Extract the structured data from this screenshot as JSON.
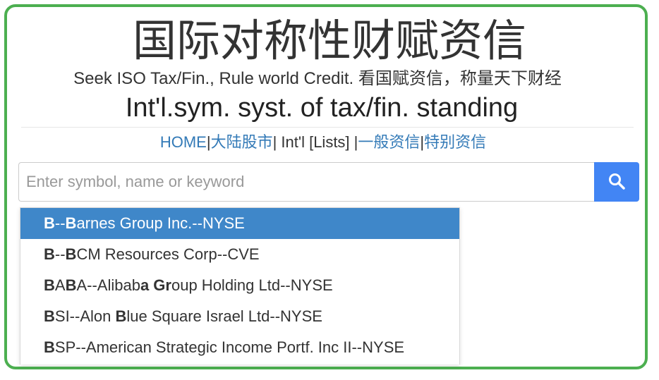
{
  "header": {
    "title": "国际对称性财赋资信",
    "subtitle": "Seek ISO Tax/Fin., Rule world Credit. 看国赋资信，称量天下财经",
    "tagline": "Int'l.sym. syst. of tax/fin. standing"
  },
  "nav": {
    "home": "HOME",
    "sep1": "|",
    "mainland_stocks": "大陆股市",
    "sep2": "|",
    "intl_lists": " Int'l [Lists] ",
    "sep3": "|",
    "general_credit": "一般资信",
    "sep4": "|",
    "special_credit": "特别资信"
  },
  "search": {
    "placeholder": "Enter symbol, name or keyword",
    "value": "",
    "button_icon": "search-icon"
  },
  "dropdown": {
    "items": [
      {
        "text": "B--Barnes Group Inc.--NYSE",
        "selected": true
      },
      {
        "text": "B--BCM Resources Corp--CVE",
        "selected": false
      },
      {
        "text": "BABA--Alibaba Group Holding Ltd--NYSE",
        "selected": false
      },
      {
        "text": "BSI--Alon Blue Square Israel Ltd--NYSE",
        "selected": false
      },
      {
        "text": "BSP--American Strategic Income Portf. Inc II--NYSE",
        "selected": false
      }
    ]
  },
  "colors": {
    "frame_border": "#4caf50",
    "link": "#337ab7",
    "search_button": "#4285f4",
    "selected_item": "#3f87c9"
  }
}
